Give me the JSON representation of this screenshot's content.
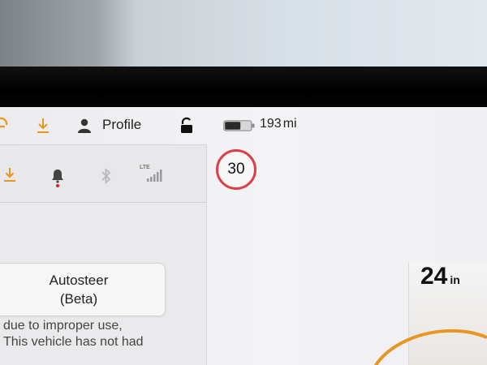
{
  "status_bar": {
    "profile_label": "Profile",
    "range_value": "193",
    "range_unit": "mi",
    "battery_level": 0.6
  },
  "quick_controls": {
    "lte_label": "LTE"
  },
  "speed_limit": "30",
  "autosteer": {
    "line1": "Autosteer",
    "line2": "(Beta)"
  },
  "warning": {
    "line1": "due to improper use,",
    "line2": "This vehicle has not had"
  },
  "distance": {
    "value": "24",
    "unit": "in"
  },
  "colors": {
    "orange": "#e8961f",
    "speed_limit_ring": "#d9404a",
    "notification_dot": "#e02020"
  },
  "icons": [
    "download-icon",
    "person-icon",
    "unlock-icon",
    "battery-icon",
    "bell-icon",
    "bluetooth-icon",
    "lte-signal-icon"
  ]
}
